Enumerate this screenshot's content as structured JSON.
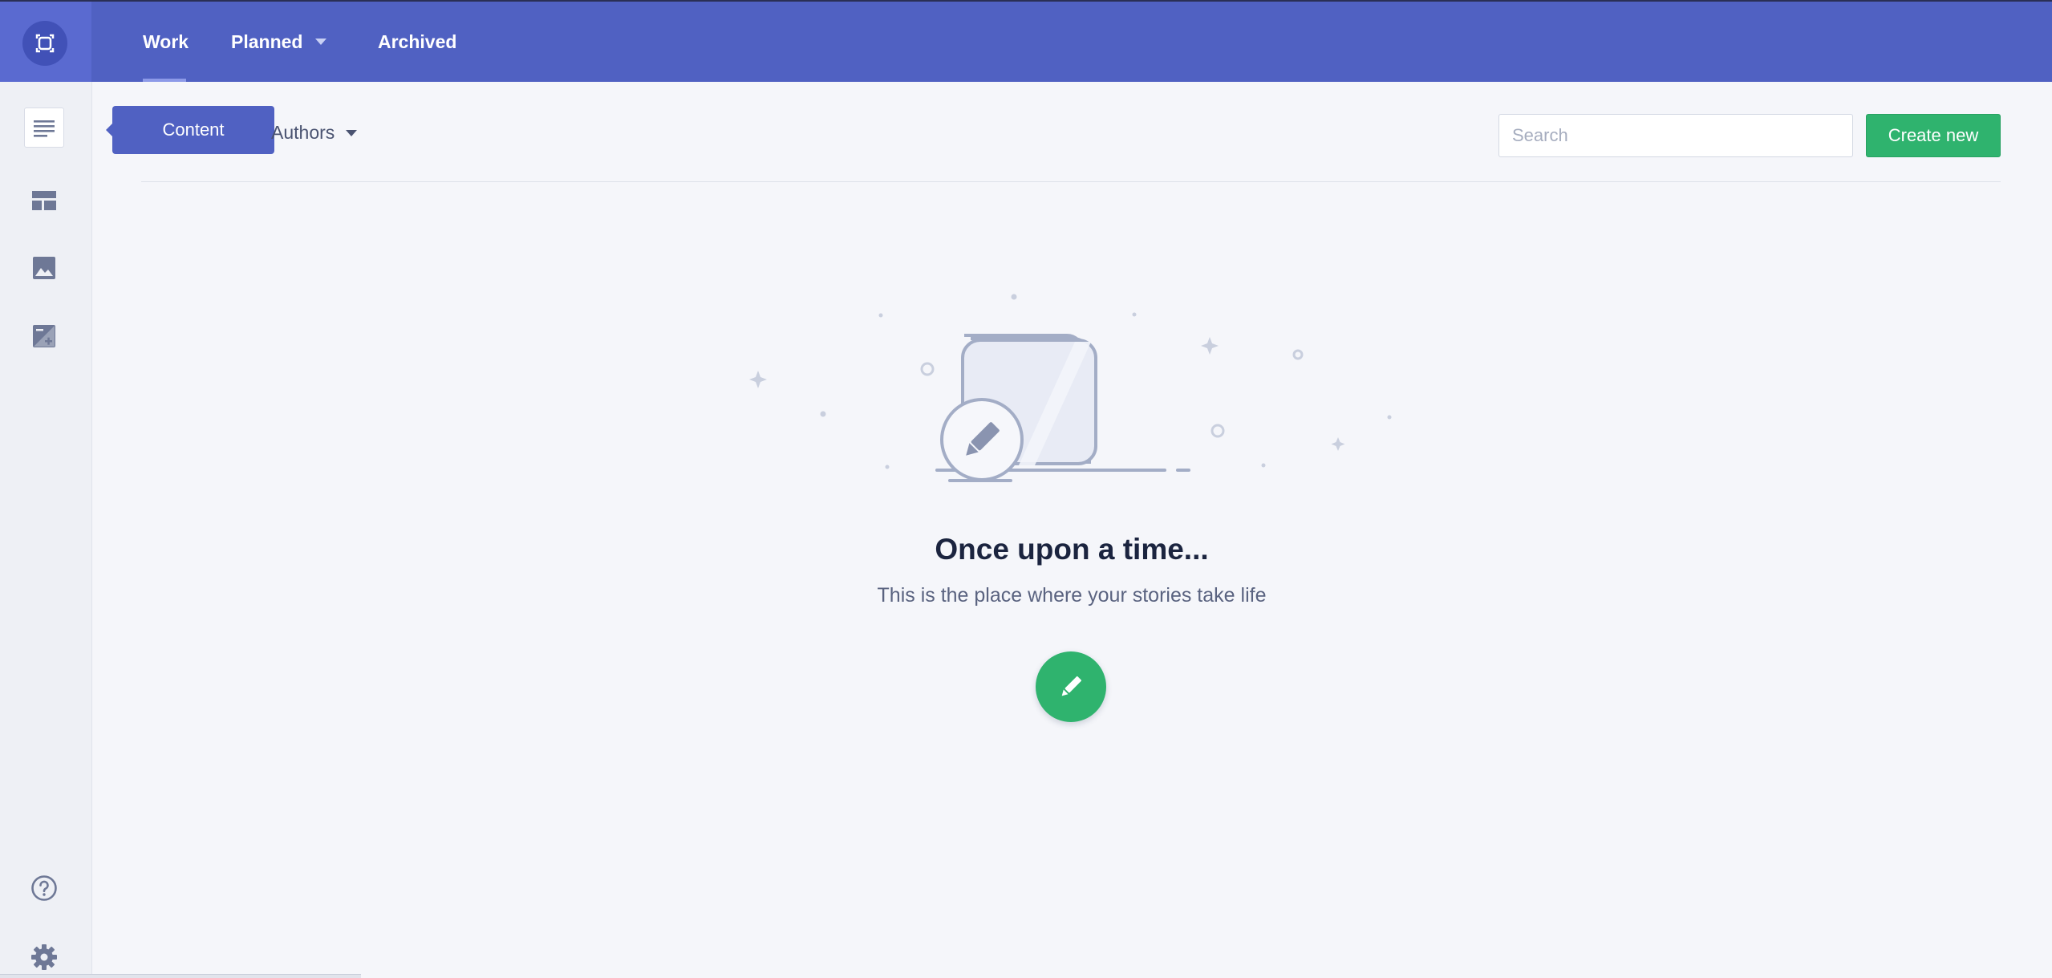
{
  "app": {
    "logo_icon": "storyblok-logo-icon"
  },
  "nav": {
    "tabs": [
      {
        "label": "Work",
        "active": true
      },
      {
        "label": "Planned",
        "has_dropdown": true
      },
      {
        "label": "Archived"
      }
    ]
  },
  "sidebar": {
    "items": [
      {
        "icon": "content-lines-icon",
        "active": true
      },
      {
        "icon": "layout-icon"
      },
      {
        "icon": "image-icon"
      },
      {
        "icon": "image-edit-icon"
      },
      {
        "icon": "help-icon"
      },
      {
        "icon": "gear-icon"
      }
    ]
  },
  "tooltip": {
    "text": "Content"
  },
  "toolbar": {
    "authors_filter": "Authors",
    "search_placeholder": "Search",
    "create_label": "Create new"
  },
  "empty_state": {
    "title": "Once upon a time...",
    "subtitle": "This is the place where your stories take life",
    "action_icon": "pencil-icon"
  },
  "colors": {
    "brand": "#5061c2",
    "success": "#2fb36e",
    "background": "#f5f6fa"
  }
}
